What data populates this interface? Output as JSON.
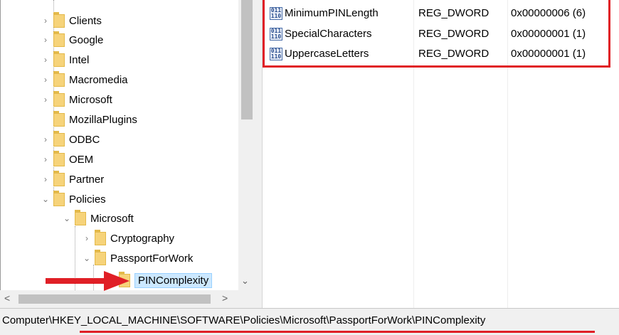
{
  "tree": {
    "items": [
      {
        "label": "Clients",
        "chevron": "›"
      },
      {
        "label": "Google",
        "chevron": "›"
      },
      {
        "label": "Intel",
        "chevron": "›"
      },
      {
        "label": "Macromedia",
        "chevron": "›"
      },
      {
        "label": "Microsoft",
        "chevron": "›"
      },
      {
        "label": "MozillaPlugins",
        "chevron": ""
      },
      {
        "label": "ODBC",
        "chevron": "›"
      },
      {
        "label": "OEM",
        "chevron": "›"
      },
      {
        "label": "Partner",
        "chevron": "›"
      },
      {
        "label": "Policies",
        "chevron": "⌄"
      },
      {
        "label": "Microsoft",
        "chevron": "⌄"
      },
      {
        "label": "Cryptography",
        "chevron": "›"
      },
      {
        "label": "PassportForWork",
        "chevron": "⌄"
      },
      {
        "label": "PINComplexity",
        "chevron": ""
      }
    ],
    "scroll_down_glyph": "⌄",
    "hscroll_left_glyph": "<",
    "hscroll_right_glyph": ">"
  },
  "values": {
    "rows": [
      {
        "name": "MinimumPINLength",
        "type": "REG_DWORD",
        "data": "0x00000006 (6)"
      },
      {
        "name": "SpecialCharacters",
        "type": "REG_DWORD",
        "data": "0x00000001 (1)"
      },
      {
        "name": "UppercaseLetters",
        "type": "REG_DWORD",
        "data": "0x00000001 (1)"
      }
    ],
    "icon_glyph": "011\n110"
  },
  "status": {
    "path": "Computer\\HKEY_LOCAL_MACHINE\\SOFTWARE\\Policies\\Microsoft\\PassportForWork\\PINComplexity"
  },
  "colors": {
    "annotation_red": "#e01f26",
    "selection": "#cce8ff",
    "folder": "#f6d37a"
  }
}
